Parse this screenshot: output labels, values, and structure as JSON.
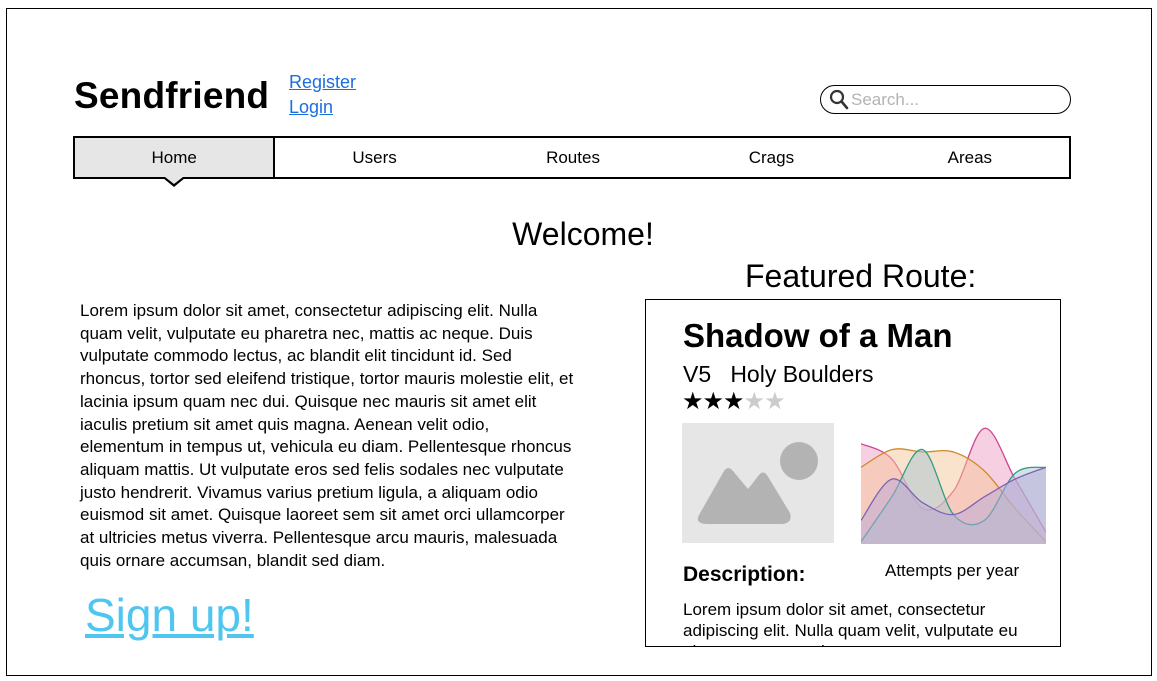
{
  "header": {
    "logo": "Sendfriend",
    "register": "Register",
    "login": "Login",
    "search_placeholder": "Search..."
  },
  "nav": {
    "tabs": [
      {
        "label": "Home",
        "active": true
      },
      {
        "label": "Users",
        "active": false
      },
      {
        "label": "Routes",
        "active": false
      },
      {
        "label": "Crags",
        "active": false
      },
      {
        "label": "Areas",
        "active": false
      }
    ]
  },
  "main": {
    "welcome": "Welcome!",
    "intro": "Lorem ipsum dolor sit amet, consectetur adipiscing elit. Nulla quam velit, vulputate eu pharetra nec, mattis ac neque. Duis vulputate commodo lectus, ac blandit elit tincidunt id. Sed rhoncus, tortor sed eleifend tristique, tortor mauris molestie elit, et lacinia ipsum quam nec dui. Quisque nec mauris sit amet elit iaculis pretium sit amet quis magna. Aenean velit odio, elementum in tempus ut, vehicula eu diam. Pellentesque rhoncus aliquam mattis. Ut vulputate eros sed felis sodales nec vulputate justo hendrerit. Vivamus varius pretium ligula, a aliquam odio euismod sit amet. Quisque laoreet sem sit amet orci ullamcorper at ultricies metus viverra. Pellentesque arcu mauris, malesuada quis ornare accumsan, blandit sed diam.",
    "signup": "Sign up!"
  },
  "featured": {
    "heading": "Featured Route:",
    "route_name": "Shadow of a Man",
    "grade": "V5",
    "area": "Holy Boulders",
    "rating": 3,
    "rating_max": 5,
    "image_icon": "image-placeholder-icon",
    "chart_caption": "Attempts per year",
    "description_label": "Description:",
    "description": "Lorem ipsum dolor sit amet, consectetur adipiscing elit. Nulla quam velit, vulputate eu pharetra nec, mattis ac neque."
  },
  "chart_data": {
    "type": "area",
    "title": "",
    "xlabel": "",
    "ylabel": "",
    "x": [
      0,
      1,
      2,
      3,
      4,
      5,
      6
    ],
    "series": [
      {
        "color": "#f0a0c8",
        "values": [
          0.85,
          0.72,
          0.3,
          0.45,
          0.98,
          0.55,
          0.1
        ]
      },
      {
        "color": "#f5c89a",
        "values": [
          0.65,
          0.8,
          0.78,
          0.78,
          0.62,
          0.3,
          0.02
        ]
      },
      {
        "color": "#a7c6cf",
        "values": [
          0.02,
          0.4,
          0.8,
          0.25,
          0.2,
          0.6,
          0.65
        ]
      },
      {
        "color": "#b9a8d8",
        "values": [
          0.2,
          0.55,
          0.35,
          0.25,
          0.4,
          0.55,
          0.65
        ]
      }
    ],
    "grid": false,
    "legend": "none"
  }
}
